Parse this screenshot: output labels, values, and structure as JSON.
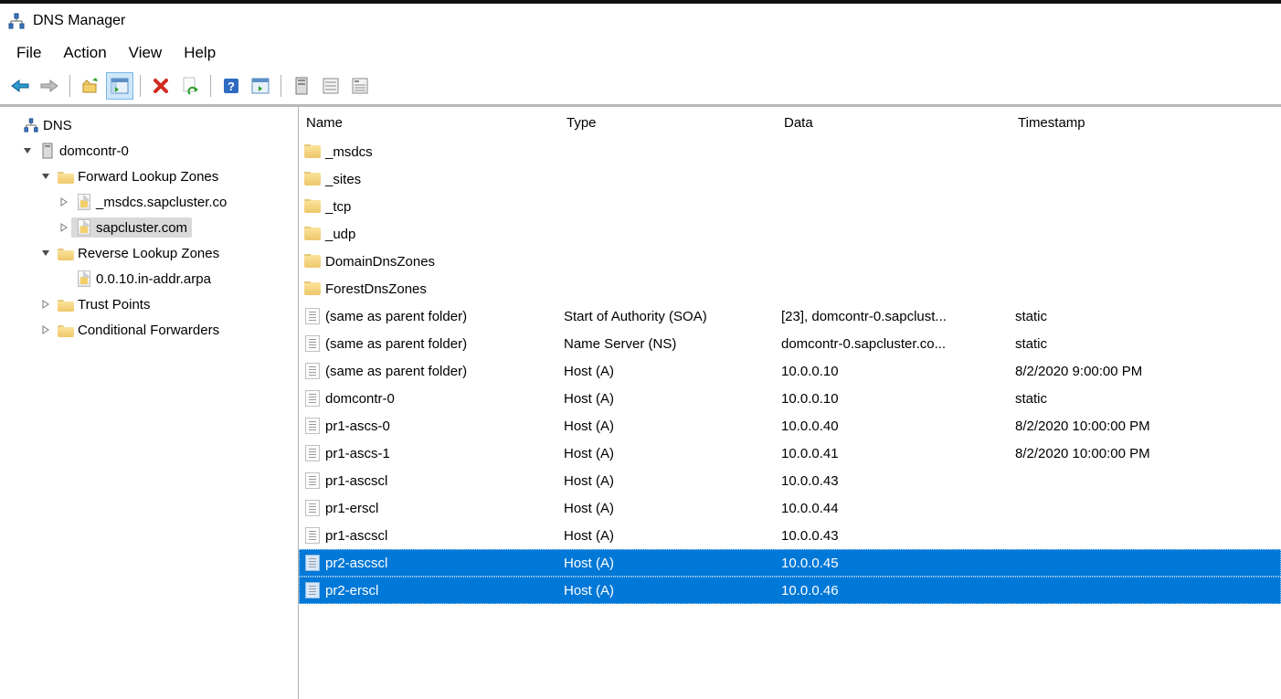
{
  "title": "DNS Manager",
  "menu": {
    "file": "File",
    "action": "Action",
    "view": "View",
    "help": "Help"
  },
  "tree": {
    "root": "DNS",
    "server": "domcontr-0",
    "fwd_zones": "Forward Lookup Zones",
    "zone_msdcs": "_msdcs.sapcluster.co",
    "zone_sap": "sapcluster.com",
    "rev_zones": "Reverse Lookup Zones",
    "rev_zone_1": "0.0.10.in-addr.arpa",
    "trust_points": "Trust Points",
    "cond_fwd": "Conditional Forwarders"
  },
  "columns": {
    "name": "Name",
    "type": "Type",
    "data": "Data",
    "timestamp": "Timestamp"
  },
  "records": [
    {
      "name": "_msdcs",
      "type": "",
      "data": "",
      "timestamp": "",
      "icon": "folder",
      "selected": false
    },
    {
      "name": "_sites",
      "type": "",
      "data": "",
      "timestamp": "",
      "icon": "folder",
      "selected": false
    },
    {
      "name": "_tcp",
      "type": "",
      "data": "",
      "timestamp": "",
      "icon": "folder",
      "selected": false
    },
    {
      "name": "_udp",
      "type": "",
      "data": "",
      "timestamp": "",
      "icon": "folder",
      "selected": false
    },
    {
      "name": "DomainDnsZones",
      "type": "",
      "data": "",
      "timestamp": "",
      "icon": "folder",
      "selected": false
    },
    {
      "name": "ForestDnsZones",
      "type": "",
      "data": "",
      "timestamp": "",
      "icon": "folder",
      "selected": false
    },
    {
      "name": "(same as parent folder)",
      "type": "Start of Authority (SOA)",
      "data": "[23], domcontr-0.sapclust...",
      "timestamp": "static",
      "icon": "record",
      "selected": false
    },
    {
      "name": "(same as parent folder)",
      "type": "Name Server (NS)",
      "data": "domcontr-0.sapcluster.co...",
      "timestamp": "static",
      "icon": "record",
      "selected": false
    },
    {
      "name": "(same as parent folder)",
      "type": "Host (A)",
      "data": "10.0.0.10",
      "timestamp": "8/2/2020 9:00:00 PM",
      "icon": "record",
      "selected": false
    },
    {
      "name": "domcontr-0",
      "type": "Host (A)",
      "data": "10.0.0.10",
      "timestamp": "static",
      "icon": "record",
      "selected": false
    },
    {
      "name": "pr1-ascs-0",
      "type": "Host (A)",
      "data": "10.0.0.40",
      "timestamp": "8/2/2020 10:00:00 PM",
      "icon": "record",
      "selected": false
    },
    {
      "name": "pr1-ascs-1",
      "type": "Host (A)",
      "data": "10.0.0.41",
      "timestamp": "8/2/2020 10:00:00 PM",
      "icon": "record",
      "selected": false
    },
    {
      "name": "pr1-ascscl",
      "type": "Host (A)",
      "data": "10.0.0.43",
      "timestamp": "",
      "icon": "record",
      "selected": false
    },
    {
      "name": "pr1-erscl",
      "type": "Host (A)",
      "data": "10.0.0.44",
      "timestamp": "",
      "icon": "record",
      "selected": false
    },
    {
      "name": "pr1-ascscl",
      "type": "Host (A)",
      "data": "10.0.0.43",
      "timestamp": "",
      "icon": "record",
      "selected": false
    },
    {
      "name": "pr2-ascscl",
      "type": "Host (A)",
      "data": "10.0.0.45",
      "timestamp": "",
      "icon": "record",
      "selected": true
    },
    {
      "name": "pr2-erscl",
      "type": "Host (A)",
      "data": "10.0.0.46",
      "timestamp": "",
      "icon": "record",
      "selected": true
    }
  ]
}
